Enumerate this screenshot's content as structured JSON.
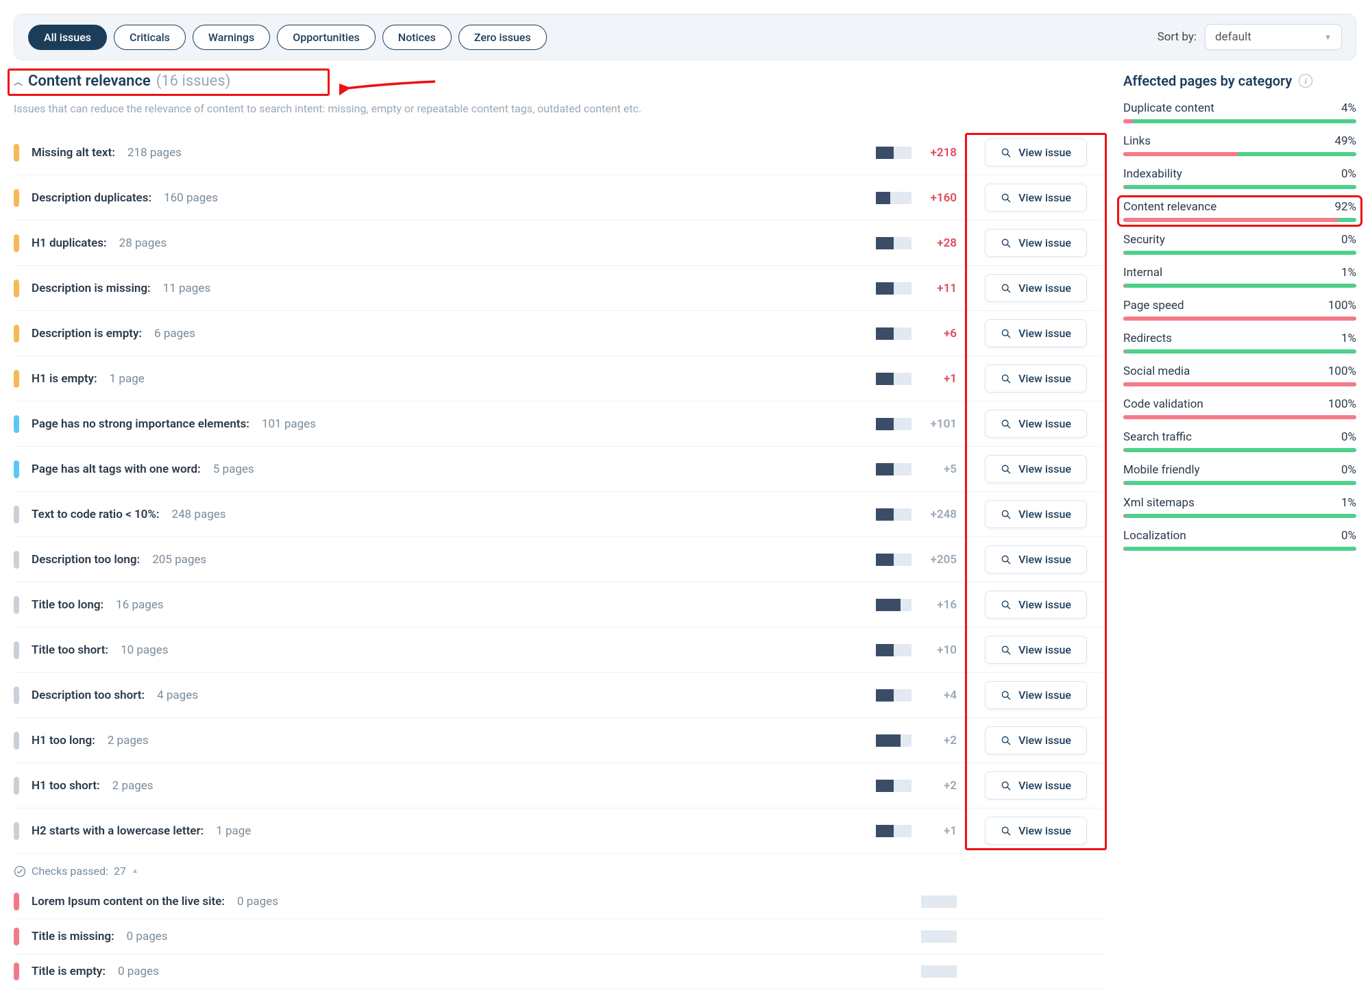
{
  "filters": [
    {
      "label": "All issues",
      "active": true
    },
    {
      "label": "Criticals",
      "active": false
    },
    {
      "label": "Warnings",
      "active": false
    },
    {
      "label": "Opportunities",
      "active": false
    },
    {
      "label": "Notices",
      "active": false
    },
    {
      "label": "Zero issues",
      "active": false
    }
  ],
  "sort": {
    "label": "Sort by:",
    "value": "default"
  },
  "section": {
    "title": "Content relevance",
    "count": "(16 issues)",
    "desc": "Issues that can reduce the relevance of content to search intent: missing, empty or repeatable content tags, outdated content etc."
  },
  "viewLabel": "View issue",
  "issues": [
    {
      "sev": "orange",
      "name": "Missing alt text:",
      "pages": "218 pages",
      "delta": "+218",
      "dcolor": "red",
      "fill": 50
    },
    {
      "sev": "orange",
      "name": "Description duplicates:",
      "pages": "160 pages",
      "delta": "+160",
      "dcolor": "red",
      "fill": 40
    },
    {
      "sev": "orange",
      "name": "H1 duplicates:",
      "pages": "28 pages",
      "delta": "+28",
      "dcolor": "red",
      "fill": 50
    },
    {
      "sev": "orange",
      "name": "Description is missing:",
      "pages": "11 pages",
      "delta": "+11",
      "dcolor": "red",
      "fill": 50
    },
    {
      "sev": "orange",
      "name": "Description is empty:",
      "pages": "6 pages",
      "delta": "+6",
      "dcolor": "red",
      "fill": 50
    },
    {
      "sev": "orange",
      "name": "H1 is empty:",
      "pages": "1 page",
      "delta": "+1",
      "dcolor": "red",
      "fill": 50
    },
    {
      "sev": "blue",
      "name": "Page has no strong importance elements:",
      "pages": "101 pages",
      "delta": "+101",
      "dcolor": "grey",
      "fill": 50
    },
    {
      "sev": "blue",
      "name": "Page has alt tags with one word:",
      "pages": "5 pages",
      "delta": "+5",
      "dcolor": "grey",
      "fill": 50
    },
    {
      "sev": "grey",
      "name": "Text to code ratio < 10%:",
      "pages": "248 pages",
      "delta": "+248",
      "dcolor": "grey",
      "fill": 50
    },
    {
      "sev": "grey",
      "name": "Description too long:",
      "pages": "205 pages",
      "delta": "+205",
      "dcolor": "grey",
      "fill": 50
    },
    {
      "sev": "grey",
      "name": "Title too long:",
      "pages": "16 pages",
      "delta": "+16",
      "dcolor": "grey",
      "fill": 70
    },
    {
      "sev": "grey",
      "name": "Title too short:",
      "pages": "10 pages",
      "delta": "+10",
      "dcolor": "grey",
      "fill": 50
    },
    {
      "sev": "grey",
      "name": "Description too short:",
      "pages": "4 pages",
      "delta": "+4",
      "dcolor": "grey",
      "fill": 50
    },
    {
      "sev": "grey",
      "name": "H1 too long:",
      "pages": "2 pages",
      "delta": "+2",
      "dcolor": "grey",
      "fill": 70
    },
    {
      "sev": "grey",
      "name": "H1 too short:",
      "pages": "2 pages",
      "delta": "+2",
      "dcolor": "grey",
      "fill": 50
    },
    {
      "sev": "grey",
      "name": "H2 starts with a lowercase letter:",
      "pages": "1 page",
      "delta": "+1",
      "dcolor": "grey",
      "fill": 50
    }
  ],
  "checksPassed": {
    "label": "Checks passed:",
    "count": "27"
  },
  "passed": [
    {
      "sev": "red",
      "name": "Lorem Ipsum content on the live site:",
      "pages": "0 pages"
    },
    {
      "sev": "red",
      "name": "Title is missing:",
      "pages": "0 pages"
    },
    {
      "sev": "red",
      "name": "Title is empty:",
      "pages": "0 pages"
    }
  ],
  "sidebar": {
    "title": "Affected pages by category",
    "cats": [
      {
        "name": "Duplicate content",
        "pct": "4%",
        "red": 4
      },
      {
        "name": "Links",
        "pct": "49%",
        "red": 49
      },
      {
        "name": "Indexability",
        "pct": "0%",
        "red": 0.5
      },
      {
        "name": "Content relevance",
        "pct": "92%",
        "red": 92,
        "highlight": true
      },
      {
        "name": "Security",
        "pct": "0%",
        "red": 0.5
      },
      {
        "name": "Internal",
        "pct": "1%",
        "red": 1
      },
      {
        "name": "Page speed",
        "pct": "100%",
        "red": 100
      },
      {
        "name": "Redirects",
        "pct": "1%",
        "red": 1
      },
      {
        "name": "Social media",
        "pct": "100%",
        "red": 100
      },
      {
        "name": "Code validation",
        "pct": "100%",
        "red": 100
      },
      {
        "name": "Search traffic",
        "pct": "0%",
        "red": 0.5
      },
      {
        "name": "Mobile friendly",
        "pct": "0%",
        "red": 0.5
      },
      {
        "name": "Xml sitemaps",
        "pct": "1%",
        "red": 1
      },
      {
        "name": "Localization",
        "pct": "0%",
        "red": 0.5
      }
    ]
  }
}
